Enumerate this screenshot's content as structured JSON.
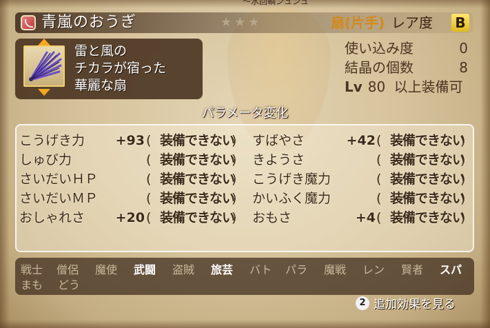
{
  "top_caption": "〜水回輌ンュンュ",
  "item": {
    "name": "青嵐のおうぎ",
    "stars": "★★★",
    "type": "扇(片手)",
    "rarity_label": "レア度",
    "rarity": "B",
    "description": [
      "雷と風の",
      "チカラが宿った",
      "華麗な扇"
    ]
  },
  "stats": {
    "usage_label": "使い込み度",
    "usage_value": "0",
    "crystal_label": "結晶の個数",
    "crystal_value": "8",
    "level_tag": "Lv",
    "level_value": "80",
    "level_suffix": "以上装備可"
  },
  "params": {
    "heading": "パラメータ変化",
    "left": [
      {
        "label": "こうげき力",
        "value": "+93",
        "open": "(",
        "status": "装備できない",
        "close": ")"
      },
      {
        "label": "しゅび力",
        "value": "",
        "open": "(",
        "status": "装備できない",
        "close": ")"
      },
      {
        "label": "さいだいＨＰ",
        "value": "",
        "open": "(",
        "status": "装備できない",
        "close": ")"
      },
      {
        "label": "さいだいＭＰ",
        "value": "",
        "open": "(",
        "status": "装備できない",
        "close": ")"
      },
      {
        "label": "おしゃれさ",
        "value": "+20",
        "open": "(",
        "status": "装備できない",
        "close": ")"
      }
    ],
    "right": [
      {
        "label": "すばやさ",
        "value": "+42",
        "open": "(",
        "status": "装備できない",
        "close": ")"
      },
      {
        "label": "きようさ",
        "value": "",
        "open": "(",
        "status": "装備できない",
        "close": ")"
      },
      {
        "label": "こうげき魔力",
        "value": "",
        "open": "(",
        "status": "装備できない",
        "close": ")"
      },
      {
        "label": "かいふく魔力",
        "value": "",
        "open": "(",
        "status": "装備できない",
        "close": ")"
      },
      {
        "label": "おもさ",
        "value": "+4",
        "open": "(",
        "status": "装備できない",
        "close": ")"
      }
    ]
  },
  "jobs": [
    {
      "name": "戦士",
      "on": false
    },
    {
      "name": "僧侶",
      "on": false
    },
    {
      "name": "魔使",
      "on": false
    },
    {
      "name": "武闘",
      "on": true
    },
    {
      "name": "盗賊",
      "on": false
    },
    {
      "name": "旅芸",
      "on": true
    },
    {
      "name": "バト",
      "on": false
    },
    {
      "name": "パラ",
      "on": false
    },
    {
      "name": "魔戦",
      "on": false
    },
    {
      "name": "レン",
      "on": false
    },
    {
      "name": "賢者",
      "on": false
    },
    {
      "name": "スパ",
      "on": true
    },
    {
      "name": "まも",
      "on": false
    },
    {
      "name": "どう",
      "on": false
    }
  ],
  "more_effects": {
    "button": "2",
    "label": "追加効果を見る"
  },
  "colors": {
    "type_accent": "#d4891c",
    "rarity_badge": "#f0cc30",
    "job_enabled": "#ffffff",
    "job_disabled": "#c9b79a"
  }
}
